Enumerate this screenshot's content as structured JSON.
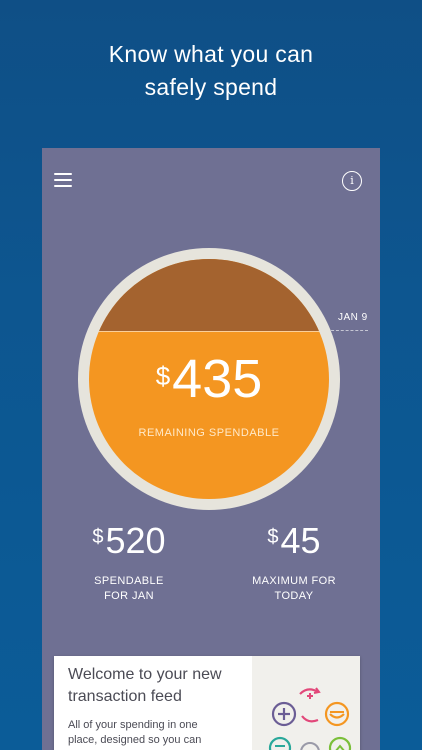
{
  "headline": {
    "line1": "Know what you can",
    "line2": "safely spend"
  },
  "toolbar": {
    "menu_icon": "hamburger-menu-icon",
    "info_icon": "info-icon",
    "info_glyph": "i"
  },
  "gauge": {
    "currency": "$",
    "amount": "435",
    "label": "REMAINING SPENDABLE",
    "date_marker": "JAN 9",
    "fill_color": "#f49621",
    "used_color": "#a4632f",
    "used_fraction": 0.3
  },
  "stats": [
    {
      "currency": "$",
      "amount": "520",
      "label_line1": "SPENDABLE",
      "label_line2": "FOR JAN"
    },
    {
      "currency": "$",
      "amount": "45",
      "label_line1": "MAXIMUM FOR",
      "label_line2": "TODAY"
    }
  ],
  "feed_card": {
    "title_line1": "Welcome to your new",
    "title_line2": "transaction feed",
    "body_line1": "All of your spending in one",
    "body_line2": "place, designed so you can",
    "art": "transaction-icons-illustration"
  },
  "colors": {
    "background": "#0d5690",
    "app_surface": "#6f7093",
    "accent_orange": "#f49621"
  }
}
